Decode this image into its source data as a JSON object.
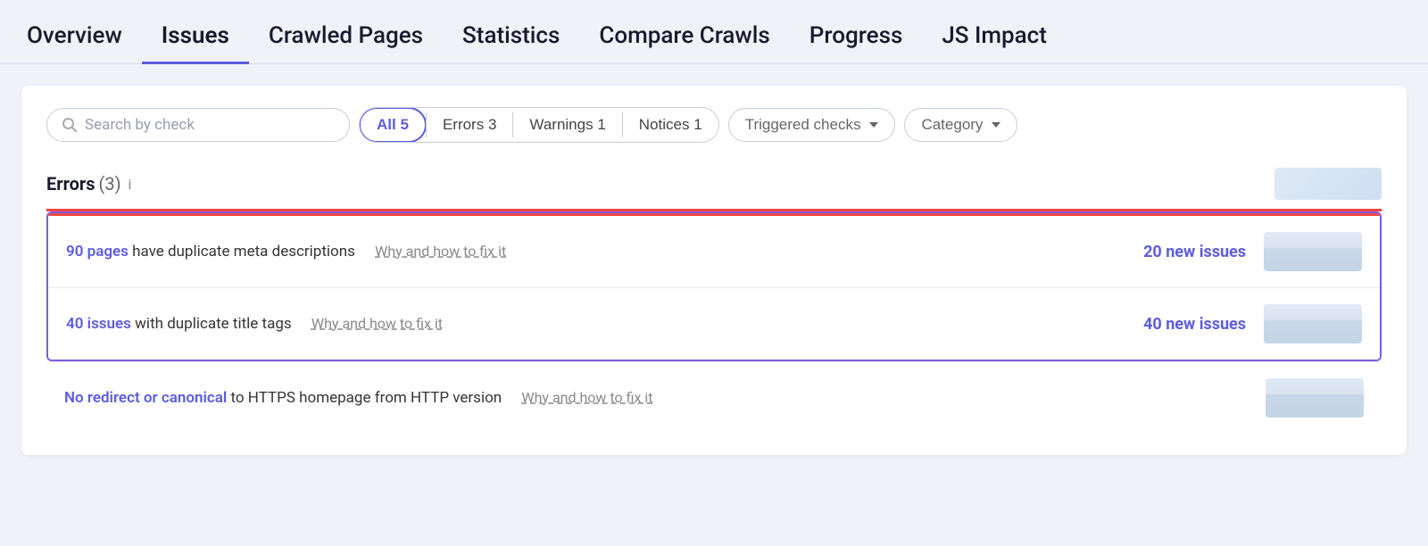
{
  "nav": {
    "tabs": [
      {
        "label": "Overview",
        "active": false
      },
      {
        "label": "Issues",
        "active": true
      },
      {
        "label": "Crawled Pages",
        "active": false
      },
      {
        "label": "Statistics",
        "active": false
      },
      {
        "label": "Compare Crawls",
        "active": false
      },
      {
        "label": "Progress",
        "active": false
      },
      {
        "label": "JS Impact",
        "active": false
      }
    ]
  },
  "filters": {
    "search_placeholder": "Search by check",
    "chips": [
      {
        "label": "All",
        "count": "5",
        "active": true
      },
      {
        "label": "Errors",
        "count": "3",
        "active": false
      },
      {
        "label": "Warnings",
        "count": "1",
        "active": false
      },
      {
        "label": "Notices",
        "count": "1",
        "active": false
      }
    ],
    "dropdowns": [
      {
        "label": "Triggered checks"
      },
      {
        "label": "Category"
      }
    ]
  },
  "section": {
    "title": "Errors",
    "count": "(3)",
    "info": "i"
  },
  "issues": [
    {
      "link_text": "90 pages",
      "description": " have duplicate meta descriptions",
      "why_label": "Why and how to fix it",
      "new_issues_label": "20 new issues",
      "highlighted": true
    },
    {
      "link_text": "40 issues",
      "description": " with duplicate title tags",
      "why_label": "Why and how to fix it",
      "new_issues_label": "40 new issues",
      "highlighted": true
    },
    {
      "link_text": "No redirect or canonical",
      "description": " to HTTPS homepage from HTTP version",
      "why_label": "Why and how to fix it",
      "new_issues_label": "",
      "highlighted": false
    }
  ]
}
